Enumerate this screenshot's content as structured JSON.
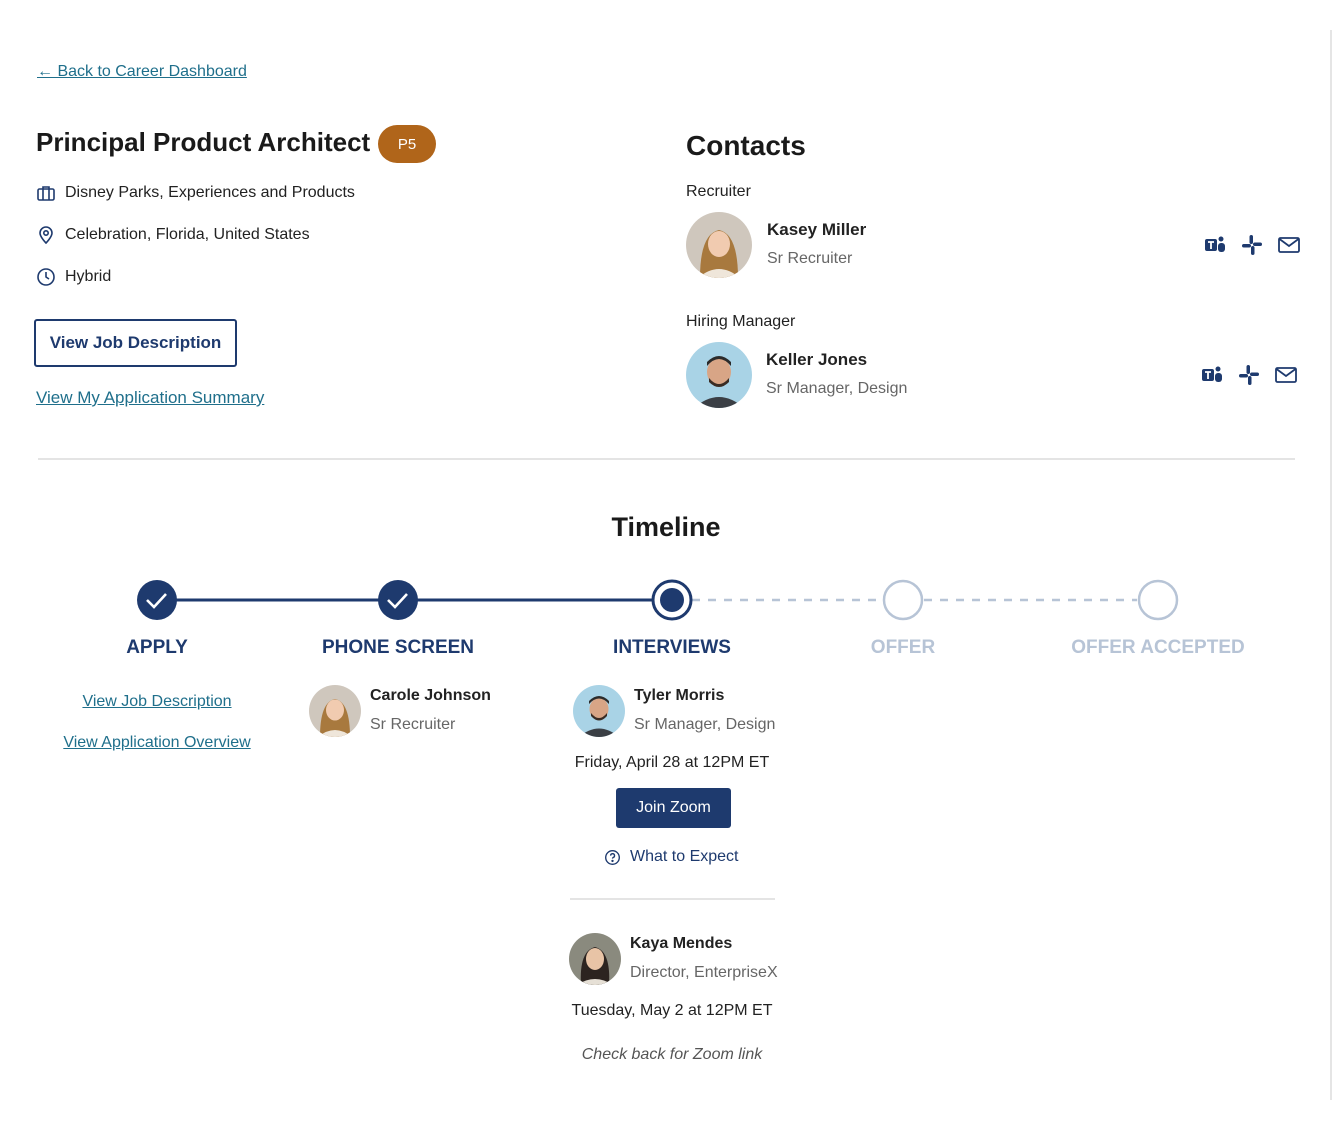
{
  "nav": {
    "back_arrow": "←",
    "back_label": " Back to Career Dashboard"
  },
  "job": {
    "title": "Principal Product Architect",
    "level": "P5",
    "department": "Disney Parks, Experiences and Products",
    "location": "Celebration, Florida, United States",
    "work_mode": "Hybrid",
    "view_description_button": "View Job Description",
    "view_summary_link": "View My Application Summary"
  },
  "contacts": {
    "title": "Contacts",
    "recruiter": {
      "role": "Recruiter",
      "name": "Kasey Miller",
      "title": "Sr Recruiter"
    },
    "hiring_manager": {
      "role": "Hiring Manager",
      "name": "Keller Jones",
      "title": "Sr Manager, Design"
    },
    "icons": [
      "teams-icon",
      "slack-icon",
      "mail-icon"
    ]
  },
  "timeline": {
    "title": "Timeline",
    "steps": [
      {
        "label": "APPLY",
        "state": "complete"
      },
      {
        "label": "PHONE SCREEN",
        "state": "complete"
      },
      {
        "label": "INTERVIEWS",
        "state": "current"
      },
      {
        "label": "OFFER",
        "state": "pending"
      },
      {
        "label": "OFFER ACCEPTED",
        "state": "pending"
      }
    ],
    "apply": {
      "link1": "View Job Description",
      "link2": "View Application Overview"
    },
    "phone_screen": {
      "name": "Carole Johnson",
      "title": "Sr Recruiter"
    },
    "interviews": [
      {
        "name": "Tyler Morris",
        "title": "Sr Manager, Design",
        "date": "Friday, April 28 at 12PM ET",
        "button": "Join Zoom",
        "expect": "What to Expect"
      },
      {
        "name": "Kaya Mendes",
        "title": "Director, EnterpriseX",
        "date": "Tuesday, May 2 at 12PM ET",
        "note": "Check back for Zoom link"
      }
    ]
  },
  "colors": {
    "primary": "#1e3a6e",
    "link": "#1f6f8b",
    "badge": "#b0651a",
    "pending": "#b7c4d6"
  }
}
